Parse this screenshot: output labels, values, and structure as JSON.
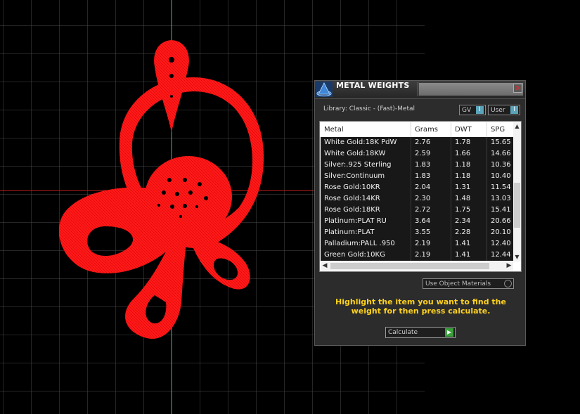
{
  "panel": {
    "title": "METAL WEIGHTS",
    "close_glyph": "✕",
    "library_label": "Library: Classic - (Fast)-Metal",
    "gv_label": "GV",
    "user_label": "User",
    "toggle_glyph": "I",
    "use_object_label": "Use Object Materials",
    "instructions": "Highlight the item you want to find the weight for then press calculate.",
    "calculate_label": "Calculate",
    "calculate_glyph": "▶"
  },
  "table": {
    "columns": [
      "Metal",
      "Grams",
      "DWT",
      "SPG"
    ],
    "rows": [
      [
        "White Gold:18K PdW",
        "2.76",
        "1.78",
        "15.65"
      ],
      [
        "White Gold:18KW",
        "2.59",
        "1.66",
        "14.66"
      ],
      [
        "Silver:.925 Sterling",
        "1.83",
        "1.18",
        "10.36"
      ],
      [
        "Silver:Continuum",
        "1.83",
        "1.18",
        "10.40"
      ],
      [
        "Rose Gold:10KR",
        "2.04",
        "1.31",
        "11.54"
      ],
      [
        "Rose Gold:14KR",
        "2.30",
        "1.48",
        "13.03"
      ],
      [
        "Rose Gold:18KR",
        "2.72",
        "1.75",
        "15.41"
      ],
      [
        "Platinum:PLAT RU",
        "3.64",
        "2.34",
        "20.66"
      ],
      [
        "Platinum:PLAT",
        "3.55",
        "2.28",
        "20.10"
      ],
      [
        "Palladium:PALL .950",
        "2.19",
        "1.41",
        "12.40"
      ],
      [
        "Green Gold:10KG",
        "2.19",
        "1.41",
        "12.44"
      ]
    ],
    "scroll_up": "▲",
    "scroll_down": "▼",
    "scroll_left": "◀",
    "scroll_right": "▶"
  },
  "colors": {
    "model": "#ff1a1a",
    "grid": "#5a5a5a",
    "axis_vertical": "#2fb7b7",
    "axis_horizontal": "#c01c1c",
    "highlight_text": "#ffd21f"
  },
  "icons": {
    "app": "pyramid-logo-icon",
    "close": "close-icon"
  }
}
